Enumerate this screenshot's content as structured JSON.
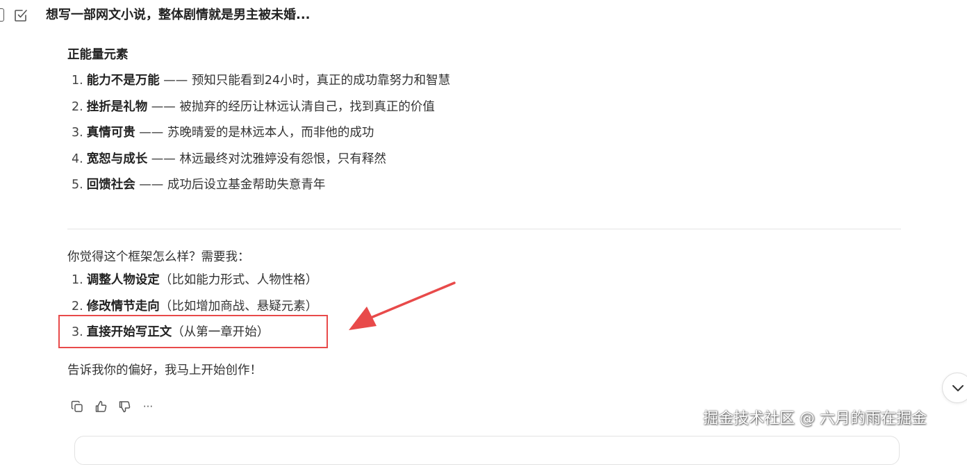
{
  "header": {
    "title": "想写一部网文小说，整体剧情就是男主被未婚..."
  },
  "message": {
    "section_title": "正能量元素",
    "elements": [
      {
        "num": "1.",
        "bold": "能力不是万能",
        "rest": " —— 预知只能看到24小时，真正的成功靠努力和智慧"
      },
      {
        "num": "2.",
        "bold": "挫折是礼物",
        "rest": " —— 被抛弃的经历让林远认清自己，找到真正的价值"
      },
      {
        "num": "3.",
        "bold": "真情可贵",
        "rest": " —— 苏晚晴爱的是林远本人，而非他的成功"
      },
      {
        "num": "4.",
        "bold": "宽恕与成长",
        "rest": " —— 林远最终对沈雅婷没有怨恨，只有释然"
      },
      {
        "num": "5.",
        "bold": "回馈社会",
        "rest": " —— 成功后设立基金帮助失意青年"
      }
    ],
    "question": "你觉得这个框架怎么样？需要我：",
    "options": [
      {
        "num": "1.",
        "bold": "调整人物设定",
        "rest": "（比如能力形式、人物性格）"
      },
      {
        "num": "2.",
        "bold": "修改情节走向",
        "rest": "（比如增加商战、悬疑元素）"
      },
      {
        "num": "3.",
        "bold": "直接开始写正文",
        "rest": "（从第一章开始）"
      }
    ],
    "closing": "告诉我你的偏好，我马上开始创作！"
  },
  "actions": {
    "icons": [
      "copy-icon",
      "thumbs-up-icon",
      "thumbs-down-icon",
      "more-icon"
    ],
    "more_label": "···"
  },
  "watermark": "掘金技术社区 @ 六月的雨在掘金",
  "colors": {
    "highlight": "#e84a4a",
    "text": "#333333",
    "divider": "#e5e5e5"
  }
}
